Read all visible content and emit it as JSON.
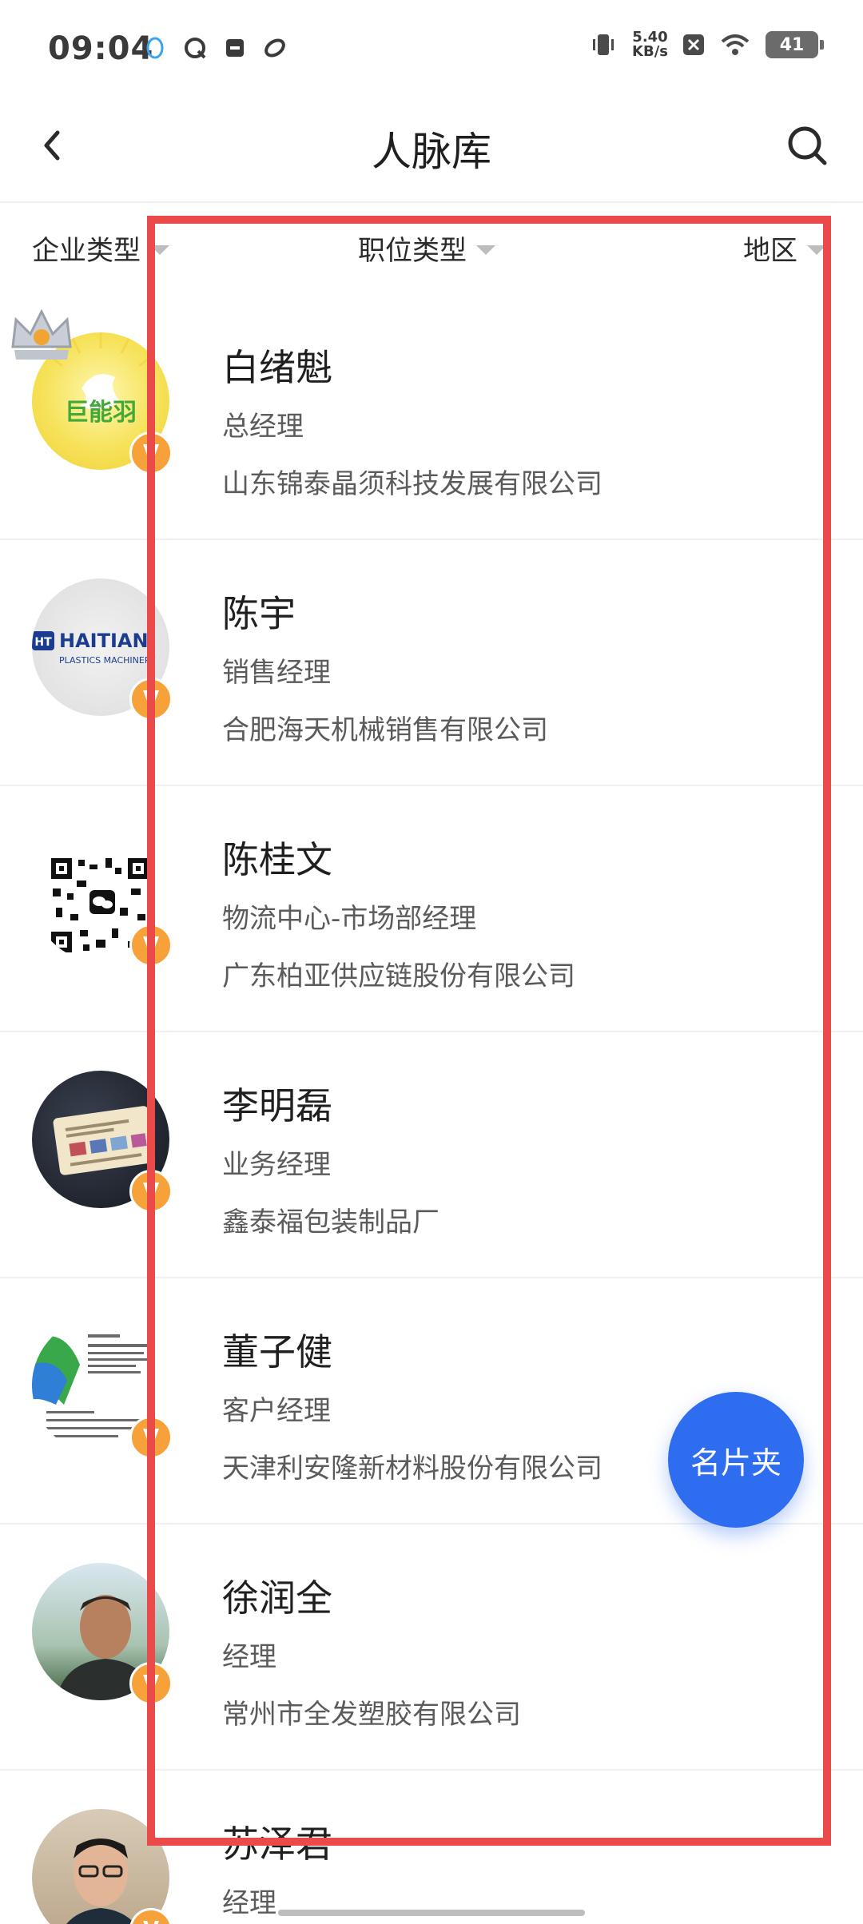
{
  "status_bar": {
    "time": "09:04",
    "net_speed_value": "5.40",
    "net_speed_unit": "KB/s",
    "battery": "41",
    "left_icons": [
      "qq-penguin-icon",
      "chat-bubble-icon",
      "archive-box-icon",
      "leaf-icon"
    ],
    "right_icons": [
      "vibrate-icon",
      "x-notification-icon",
      "wifi-icon"
    ]
  },
  "header": {
    "title": "人脉库",
    "back_icon": "chevron-left-icon",
    "search_icon": "search-icon"
  },
  "filters": {
    "company_type": "企业类型",
    "position_type": "职位类型",
    "region": "地区"
  },
  "contacts": [
    {
      "name": "白绪魁",
      "position": "总经理",
      "company": "山东锦泰晶须科技发展有限公司",
      "badge": "V",
      "avatar_text": "巨能羽",
      "crown": true
    },
    {
      "name": "陈宇",
      "position": "销售经理",
      "company": "合肥海天机械销售有限公司",
      "badge": "V",
      "avatar_text": "HAITIAN",
      "avatar_subtext": "PLASTICS MACHINERY"
    },
    {
      "name": "陈桂文",
      "position": "物流中心-市场部经理",
      "company": "广东柏亚供应链股份有限公司",
      "badge": "V"
    },
    {
      "name": "李明磊",
      "position": "业务经理",
      "company": "鑫泰福包装制品厂",
      "badge": "V"
    },
    {
      "name": "董子健",
      "position": "客户经理",
      "company": "天津利安隆新材料股份有限公司",
      "badge": "V"
    },
    {
      "name": "徐润全",
      "position": "经理",
      "company": "常州市全发塑胶有限公司",
      "badge": "V"
    },
    {
      "name": "苏泽君",
      "position": "经理",
      "company": "",
      "badge": "V"
    }
  ],
  "fab": {
    "label": "名片夹"
  },
  "colors": {
    "accent_blue": "#2f6df0",
    "highlight_red": "#ea4a4a",
    "badge_orange": "#f7a13a"
  }
}
